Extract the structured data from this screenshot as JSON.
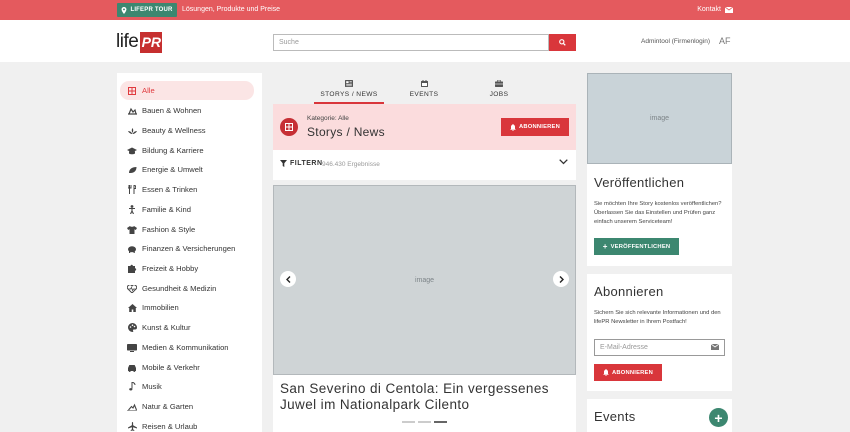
{
  "topbar": {
    "tour_label": "LIFEPR TOUR",
    "tagline": "Lösungen, Produkte und Preise",
    "kontakt": "Kontakt",
    "color": "#e45a5e"
  },
  "header": {
    "logo_text": "life",
    "logo_mark": "PR",
    "search_placeholder": "Suche",
    "login_label": "Admintool (Firmenlogin)",
    "user_initials": "AF"
  },
  "sidebar": {
    "items": [
      {
        "label": "Alle",
        "icon": "grid-icon",
        "active": true
      },
      {
        "label": "Bauen & Wohnen",
        "icon": "construction-icon"
      },
      {
        "label": "Beauty & Wellness",
        "icon": "spa-icon"
      },
      {
        "label": "Bildung & Karriere",
        "icon": "graduation-icon"
      },
      {
        "label": "Energie & Umwelt",
        "icon": "leaf-icon"
      },
      {
        "label": "Essen & Trinken",
        "icon": "cutlery-icon"
      },
      {
        "label": "Familie & Kind",
        "icon": "child-icon"
      },
      {
        "label": "Fashion & Style",
        "icon": "shirt-icon"
      },
      {
        "label": "Finanzen & Versicherungen",
        "icon": "piggy-bank-icon"
      },
      {
        "label": "Freizeit & Hobby",
        "icon": "puzzle-icon"
      },
      {
        "label": "Gesundheit & Medizin",
        "icon": "heartbeat-icon"
      },
      {
        "label": "Immobilien",
        "icon": "house-icon"
      },
      {
        "label": "Kunst & Kultur",
        "icon": "palette-icon"
      },
      {
        "label": "Medien & Kommunikation",
        "icon": "media-icon"
      },
      {
        "label": "Mobile & Verkehr",
        "icon": "car-icon"
      },
      {
        "label": "Musik",
        "icon": "music-icon"
      },
      {
        "label": "Natur & Garten",
        "icon": "tree-icon"
      },
      {
        "label": "Reisen & Urlaub",
        "icon": "plane-icon"
      }
    ]
  },
  "tabs": [
    {
      "label": "STORYS / NEWS",
      "icon": "newspaper-icon",
      "active": true
    },
    {
      "label": "EVENTS",
      "icon": "calendar-icon"
    },
    {
      "label": "JOBS",
      "icon": "briefcase-icon"
    }
  ],
  "category": {
    "label": "Kategorie: Alle",
    "title": "Storys / News",
    "subscribe": "ABONNIEREN"
  },
  "filter": {
    "label": "FILTERN",
    "results": "946.430 Ergebnisse"
  },
  "story": {
    "headline": "San Severino di Centola: Ein vergessenes Juwel im Nationalpark Cilento",
    "active_slide": 3,
    "slide_count": 3
  },
  "publish": {
    "title": "Veröffentlichen",
    "text": "Sie möchten Ihre Story kostenlos veröffentlichen? Überlassen Sie das Einstellen und Prüfen ganz einfach unserem Serviceteam!",
    "button": "VERÖFFENTLICHEN"
  },
  "subscribe": {
    "title": "Abonnieren",
    "text": "Sichern Sie sich relevante Informationen und den lifePR Newsletter in Ihrem Postfach!",
    "email_placeholder": "E-Mail-Adresse",
    "button": "ABONNIEREN"
  },
  "events": {
    "title": "Events"
  },
  "colors": {
    "accent": "#d9363b",
    "green": "#3c8770",
    "tint": "#fbdcdd"
  }
}
